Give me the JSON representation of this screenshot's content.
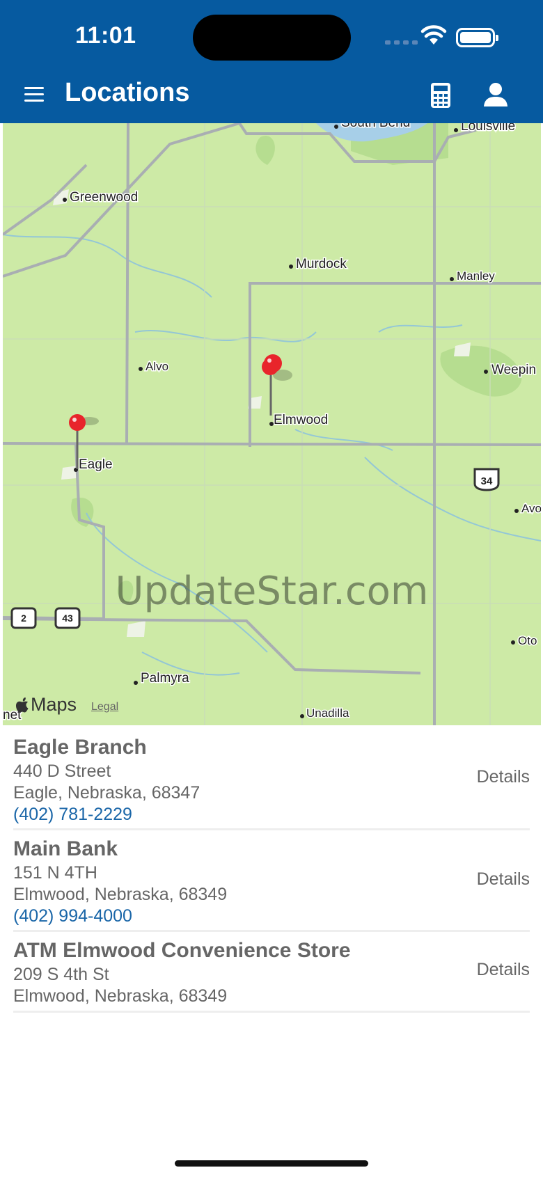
{
  "status_bar": {
    "time": "11:01"
  },
  "nav": {
    "title": "Locations"
  },
  "map": {
    "labels": {
      "south_bend": "South Bend",
      "louisville": "Louisville",
      "greenwood": "Greenwood",
      "murdock": "Murdock",
      "manley": "Manley",
      "alvo": "Alvo",
      "weeping": "Weepin",
      "elmwood": "Elmwood",
      "eagle": "Eagle",
      "avoca": "Avo",
      "otoe": "Oto",
      "palmyra": "Palmyra",
      "unadilla": "Unadilla",
      "bennet": "net"
    },
    "highway_shields": {
      "us34": "34",
      "ne2": "2",
      "ne43": "43"
    },
    "watermark": "UpdateStar.com",
    "attribution": "Maps",
    "legal": "Legal"
  },
  "locations": [
    {
      "name": "Eagle Branch",
      "street": "440 D Street",
      "city": "Eagle, Nebraska, 68347",
      "phone": "(402) 781-2229",
      "details": "Details"
    },
    {
      "name": "Main Bank",
      "street": "151 N 4TH",
      "city": "Elmwood, Nebraska, 68349",
      "phone": "(402) 994-4000",
      "details": "Details"
    },
    {
      "name": "ATM Elmwood Convenience Store",
      "street": "209 S 4th St",
      "city": "Elmwood, Nebraska, 68349",
      "details": "Details"
    }
  ],
  "colors": {
    "header": "#065aa0",
    "phone": "#1a66a8",
    "pin": "#e8252b"
  }
}
